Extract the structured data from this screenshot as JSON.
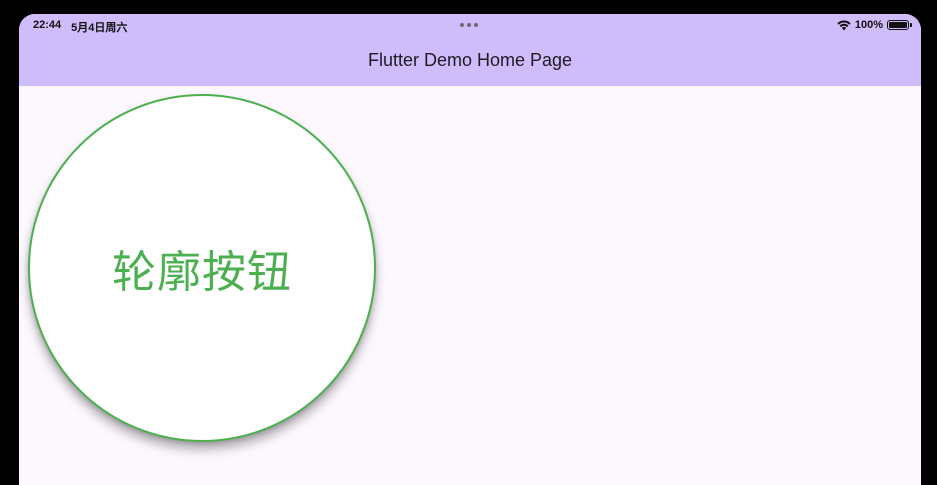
{
  "status_bar": {
    "time": "22:44",
    "date": "5月4日周六",
    "battery_percent": "100%",
    "battery_level": 1.0
  },
  "app_bar": {
    "title": "Flutter Demo Home Page",
    "color": "#cfbcfb"
  },
  "body": {
    "background": "#fdf7fe",
    "outline_button": {
      "label": "轮廓按钮",
      "border_color": "#4caf50",
      "text_color": "#4caf50"
    }
  }
}
